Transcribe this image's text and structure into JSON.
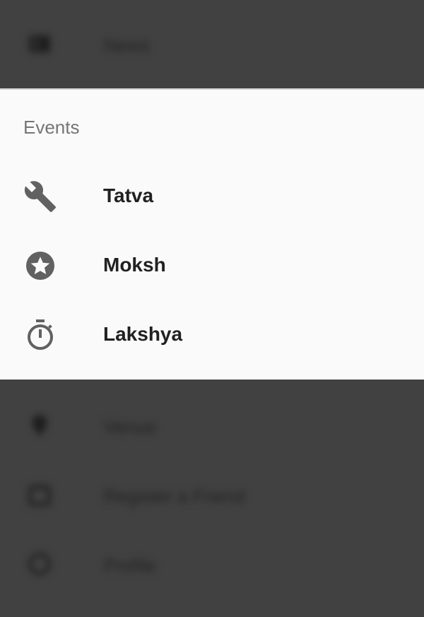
{
  "background_menu": {
    "items": [
      {
        "label": "News",
        "icon": "newspaper-icon"
      },
      {
        "label": "Venue",
        "icon": "location-pin-icon"
      },
      {
        "label": "Register a Friend",
        "icon": "calendar-icon"
      },
      {
        "label": "Profile",
        "icon": "clock-icon"
      }
    ]
  },
  "events_sheet": {
    "title": "Events",
    "items": [
      {
        "label": "Tatva",
        "icon": "wrench-icon"
      },
      {
        "label": "Moksh",
        "icon": "star-circle-icon"
      },
      {
        "label": "Lakshya",
        "icon": "stopwatch-icon"
      }
    ]
  },
  "colors": {
    "overlay": "#414141",
    "sheet_background": "#fafafa",
    "icon": "#616161",
    "title_text": "#757575",
    "item_text": "#212121"
  }
}
